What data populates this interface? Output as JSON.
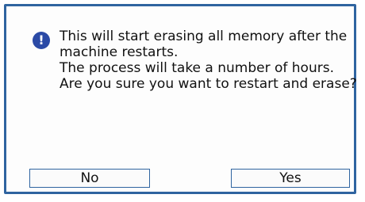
{
  "dialog": {
    "icon": "exclamation-icon",
    "icon_glyph": "!",
    "lines": [
      "This will start erasing all memory after the",
      "machine restarts.",
      "The process will take a number of hours.",
      "Are you sure you want to restart and erase?"
    ],
    "buttons": {
      "no_label": "No",
      "yes_label": "Yes"
    }
  },
  "colors": {
    "border": "#2f64a0",
    "icon_bg": "#2b4aa6"
  }
}
